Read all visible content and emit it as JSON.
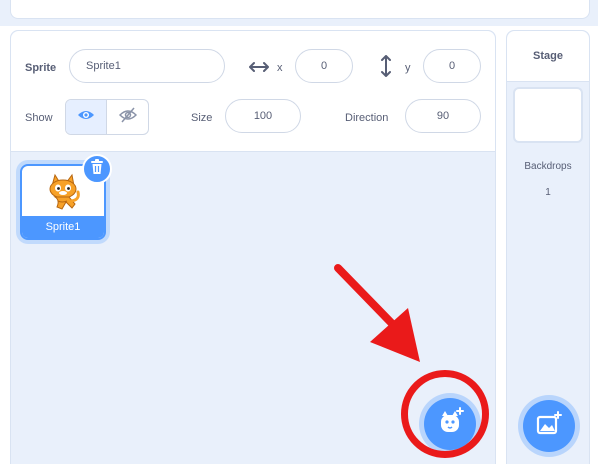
{
  "sprite_info": {
    "sprite_label": "Sprite",
    "sprite_name": "Sprite1",
    "x_label": "x",
    "x_value": "0",
    "y_label": "y",
    "y_value": "0",
    "show_label": "Show",
    "size_label": "Size",
    "size_value": "100",
    "direction_label": "Direction",
    "direction_value": "90"
  },
  "sprite_list": {
    "items": [
      {
        "name": "Sprite1",
        "selected": true
      }
    ]
  },
  "stage": {
    "title": "Stage",
    "backdrops_label": "Backdrops",
    "backdrops_count": "1"
  },
  "colors": {
    "accent": "#4c97ff",
    "pane_bg": "#e9f0fb",
    "text": "#575e75",
    "highlight_red": "#ea1a1a"
  },
  "icons": {
    "add_sprite": "cat-plus-icon",
    "add_backdrop": "image-plus-icon",
    "delete": "trash-icon",
    "show": "eye-icon",
    "hide": "eye-slash-icon",
    "x_axis": "horizontal-arrows-icon",
    "y_axis": "vertical-arrows-icon"
  }
}
